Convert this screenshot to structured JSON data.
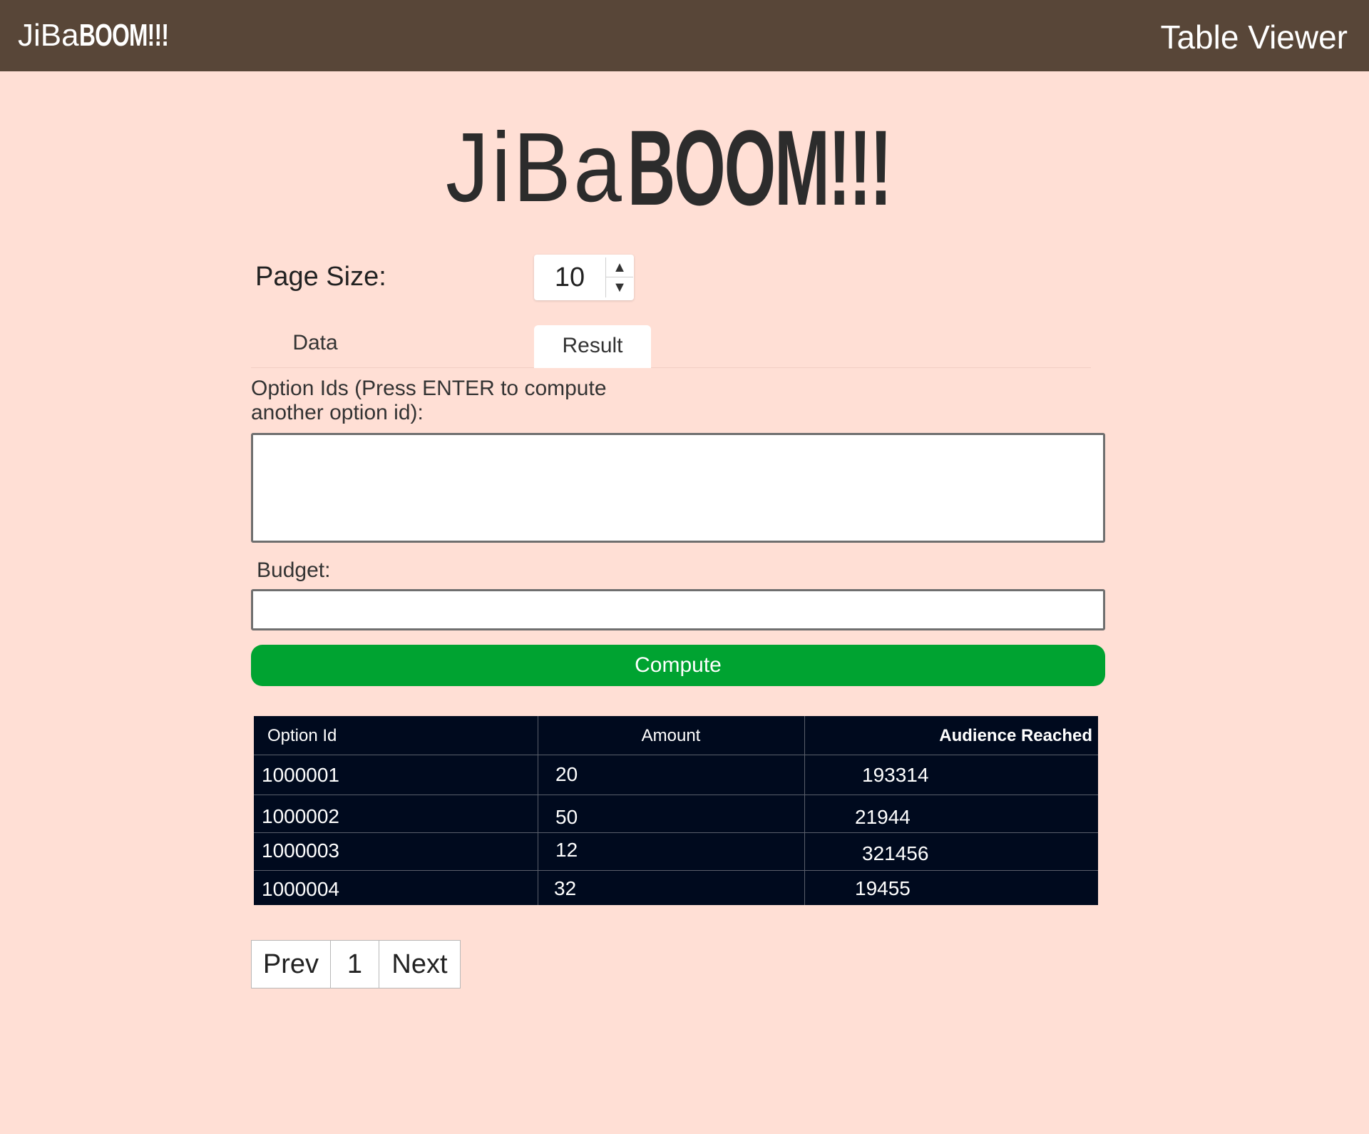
{
  "header": {
    "brand_light": "JiBa",
    "brand_bold": "BOOM!!!",
    "page_name": "Table Viewer"
  },
  "hero": {
    "logo_light": "JiBa",
    "logo_bold": "BOOM!!!"
  },
  "page_size": {
    "label": "Page Size:",
    "value": "10",
    "up_arrow": "▲",
    "down_arrow": "▼"
  },
  "tabs": [
    {
      "label": "Data",
      "active": false
    },
    {
      "label": "Result",
      "active": true
    }
  ],
  "form": {
    "option_ids_label": "Option Ids (Press ENTER to compute another option id):",
    "option_ids_value": "",
    "budget_label": "Budget:",
    "budget_value": "",
    "compute_label": "Compute",
    "compute_color": "#00a331"
  },
  "table": {
    "columns": [
      "Option Id",
      "Amount",
      "Audience Reached"
    ],
    "rows": [
      [
        "1000001",
        "20",
        "193314"
      ],
      [
        "1000002",
        "50",
        "21944"
      ],
      [
        "1000003",
        "12",
        "321456"
      ],
      [
        "1000004",
        "32",
        "19455"
      ]
    ]
  },
  "pagination": {
    "prev_label": "Prev",
    "current_page": "1",
    "next_label": "Next"
  },
  "colors": {
    "topbar": "#584638",
    "background": "#ffdfd5",
    "table_bg": "#000a1e"
  }
}
